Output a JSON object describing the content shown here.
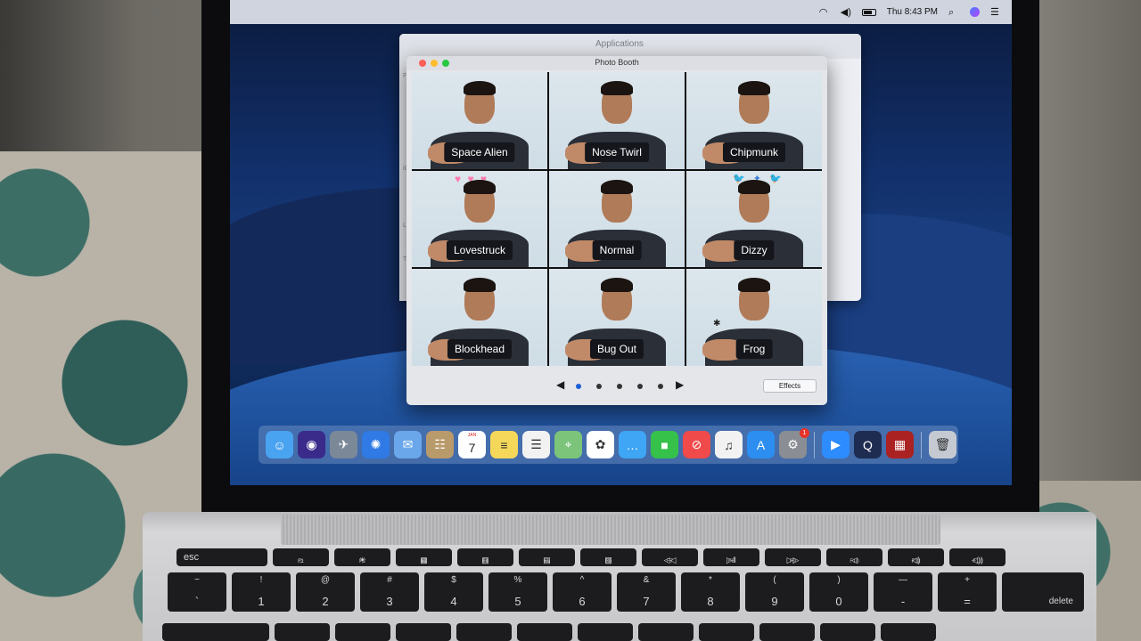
{
  "menubar": {
    "clock": "Thu 8:43 PM",
    "icons": [
      "wifi-icon",
      "volume-icon",
      "battery-icon",
      "spotlight-icon",
      "siri-icon",
      "notification-center-icon"
    ]
  },
  "finder": {
    "title": "Applications",
    "sidebar_labels": [
      "Fav",
      "iCl",
      "Loc",
      "Tag"
    ]
  },
  "photo_booth": {
    "title": "Photo Booth",
    "effects": [
      {
        "label": "Space Alien",
        "decoration": ""
      },
      {
        "label": "Nose Twirl",
        "decoration": ""
      },
      {
        "label": "Chipmunk",
        "decoration": ""
      },
      {
        "label": "Lovestruck",
        "decoration": "hearts"
      },
      {
        "label": "Normal",
        "decoration": ""
      },
      {
        "label": "Dizzy",
        "decoration": "birds"
      },
      {
        "label": "Blockhead",
        "decoration": ""
      },
      {
        "label": "Bug Out",
        "decoration": ""
      },
      {
        "label": "Frog",
        "decoration": "flies"
      }
    ],
    "pager": {
      "pages": 5,
      "current": 1,
      "prev_icon": "triangle-left-icon",
      "next_icon": "triangle-right-icon"
    },
    "effects_button": "Effects"
  },
  "dock": {
    "items": [
      {
        "name": "finder",
        "color": "#4aa3f0",
        "glyph": "☺"
      },
      {
        "name": "siri",
        "color": "#3a2a8a",
        "glyph": "◉"
      },
      {
        "name": "launchpad",
        "color": "#7b8898",
        "glyph": "✈"
      },
      {
        "name": "safari",
        "color": "#2f7ae5",
        "glyph": "✺"
      },
      {
        "name": "mail",
        "color": "#6aa7ea",
        "glyph": "✉"
      },
      {
        "name": "contacts",
        "color": "#b99a6a",
        "glyph": "☷"
      },
      {
        "name": "calendar",
        "color": "#ffffff",
        "glyph": "",
        "month": "JAN",
        "day": "7"
      },
      {
        "name": "notes",
        "color": "#f5d85a",
        "glyph": "≡"
      },
      {
        "name": "reminders",
        "color": "#f2f2f2",
        "glyph": "☰"
      },
      {
        "name": "maps",
        "color": "#7cc47a",
        "glyph": "⌖"
      },
      {
        "name": "photos",
        "color": "#ffffff",
        "glyph": "✿"
      },
      {
        "name": "messages",
        "color": "#3fa6f5",
        "glyph": "…"
      },
      {
        "name": "facetime",
        "color": "#36c24a",
        "glyph": "■"
      },
      {
        "name": "news",
        "color": "#f04a4a",
        "glyph": "⊘"
      },
      {
        "name": "music",
        "color": "#f2f2f2",
        "glyph": "♫"
      },
      {
        "name": "app-store",
        "color": "#2b8ef0",
        "glyph": "A"
      },
      {
        "name": "system-preferences",
        "color": "#8a8d93",
        "glyph": "⚙",
        "badge": "1"
      },
      {
        "name": "separator"
      },
      {
        "name": "zoom",
        "color": "#2d8cff",
        "glyph": "▶"
      },
      {
        "name": "quicktime",
        "color": "#1e2c52",
        "glyph": "Q"
      },
      {
        "name": "photo-booth",
        "color": "#a22",
        "glyph": "▦"
      },
      {
        "name": "separator"
      },
      {
        "name": "trash",
        "color": "#c5cad2",
        "glyph": "🗑"
      }
    ]
  },
  "keyboard": {
    "fn_row": [
      "esc",
      "F1",
      "F2",
      "F3",
      "F4",
      "F5",
      "F6",
      "F7",
      "F8",
      "F9",
      "F10",
      "F11",
      "F12"
    ],
    "fn_icons": [
      "",
      "☼",
      "☀",
      "▦",
      "▥",
      "▤",
      "▧",
      "◁◁",
      "▷‖",
      "▷▷",
      "◁",
      "◁)",
      "◁))"
    ],
    "number_row": [
      {
        "top": "~",
        "bottom": "`"
      },
      {
        "top": "!",
        "bottom": "1"
      },
      {
        "top": "@",
        "bottom": "2"
      },
      {
        "top": "#",
        "bottom": "3"
      },
      {
        "top": "$",
        "bottom": "4"
      },
      {
        "top": "%",
        "bottom": "5"
      },
      {
        "top": "^",
        "bottom": "6"
      },
      {
        "top": "&",
        "bottom": "7"
      },
      {
        "top": "*",
        "bottom": "8"
      },
      {
        "top": "(",
        "bottom": "9"
      },
      {
        "top": ")",
        "bottom": "0"
      },
      {
        "top": "—",
        "bottom": "-"
      },
      {
        "top": "+",
        "bottom": "="
      }
    ],
    "delete_label": "delete"
  }
}
